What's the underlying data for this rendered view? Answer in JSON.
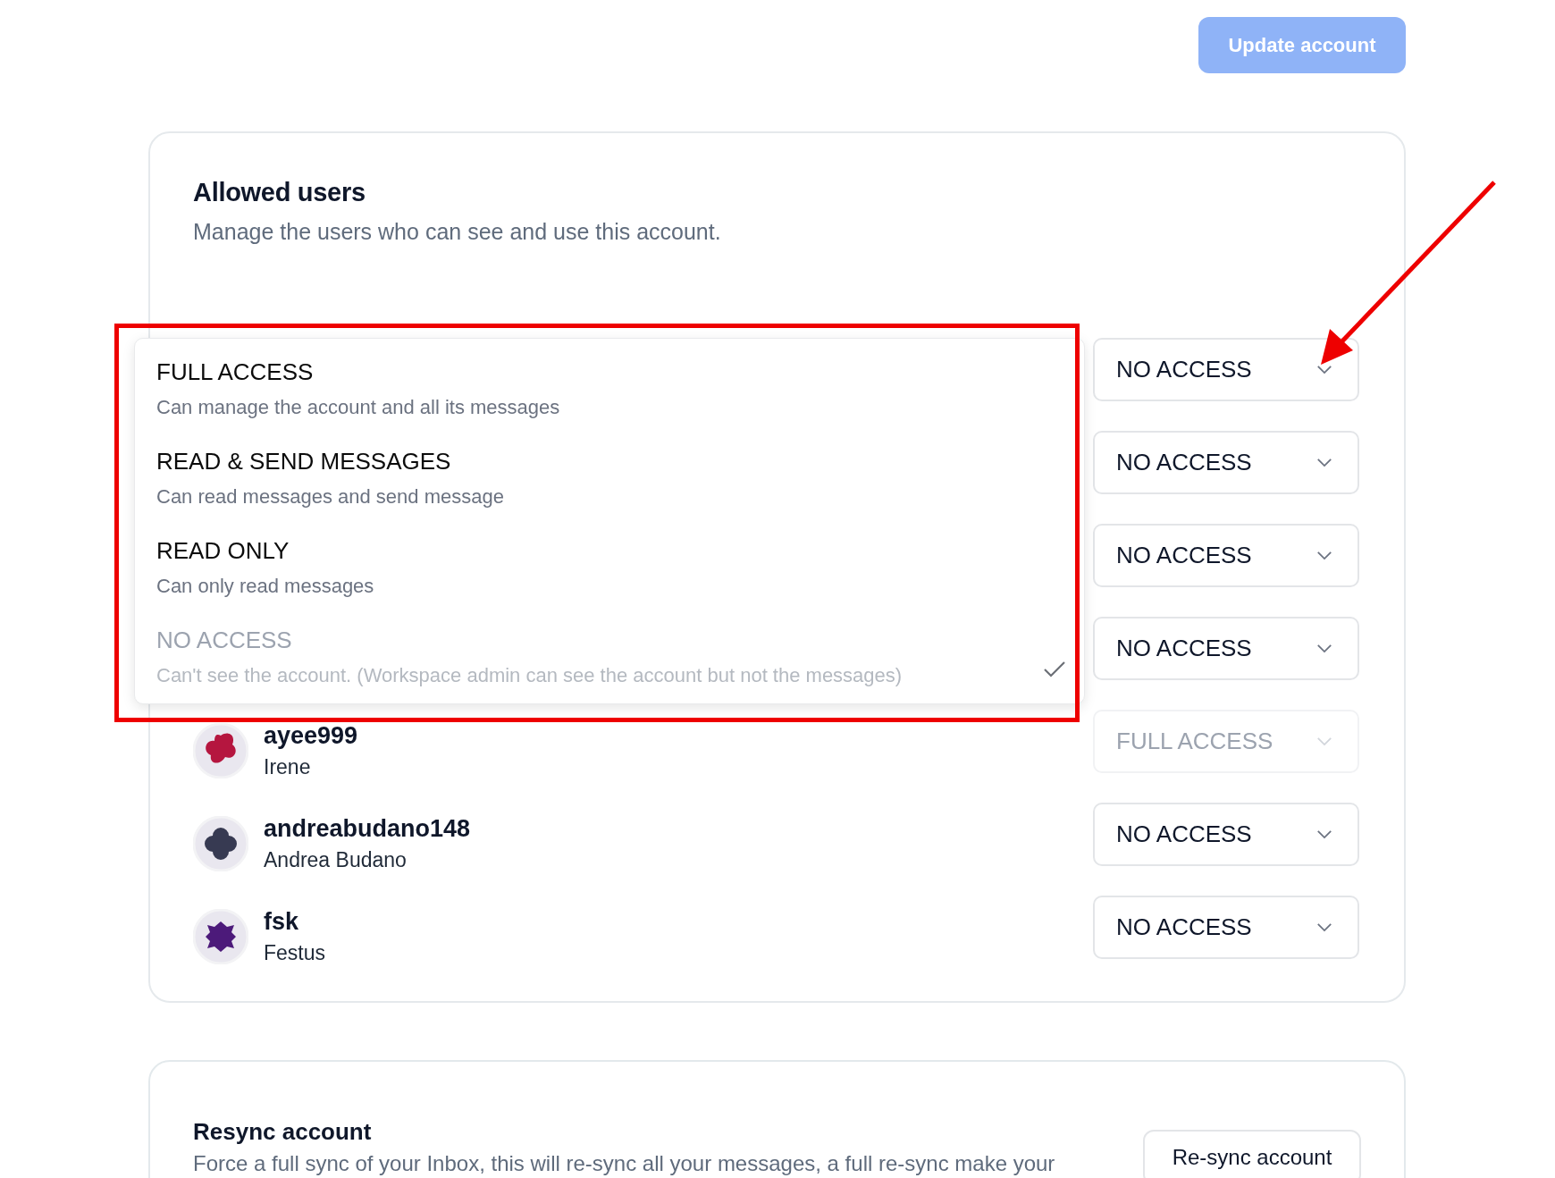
{
  "update_button": "Update account",
  "allowed_users": {
    "title": "Allowed users",
    "subtitle": "Manage the users who can see and use this account.",
    "users": [
      {
        "access": "NO ACCESS",
        "disabled": false
      },
      {
        "access": "NO ACCESS",
        "disabled": false
      },
      {
        "access": "NO ACCESS",
        "disabled": false
      },
      {
        "access": "NO ACCESS",
        "disabled": false
      },
      {
        "username": "ayee999",
        "name": "Irene",
        "color": "#b5163f",
        "access": "FULL ACCESS",
        "disabled": true
      },
      {
        "username": "andreabudano148",
        "name": "Andrea Budano",
        "color": "#373a52",
        "access": "NO ACCESS",
        "disabled": false
      },
      {
        "username": "fsk",
        "name": "Festus",
        "color": "#4c1a7a",
        "access": "NO ACCESS",
        "disabled": false
      }
    ],
    "access_menu": [
      {
        "label": "FULL ACCESS",
        "description": "Can manage the account and all its messages",
        "selected": false
      },
      {
        "label": "READ & SEND MESSAGES",
        "description": "Can read messages and send message",
        "selected": false
      },
      {
        "label": "READ ONLY",
        "description": "Can only read messages",
        "selected": false
      },
      {
        "label": "NO ACCESS",
        "description": "Can't see the account. (Workspace admin can see the account but not the messages)",
        "selected": true
      }
    ]
  },
  "resync": {
    "title": "Resync account",
    "description": "Force a full sync of your Inbox, this will re-sync all your messages, a full re-sync make your",
    "button": "Re-sync account"
  }
}
